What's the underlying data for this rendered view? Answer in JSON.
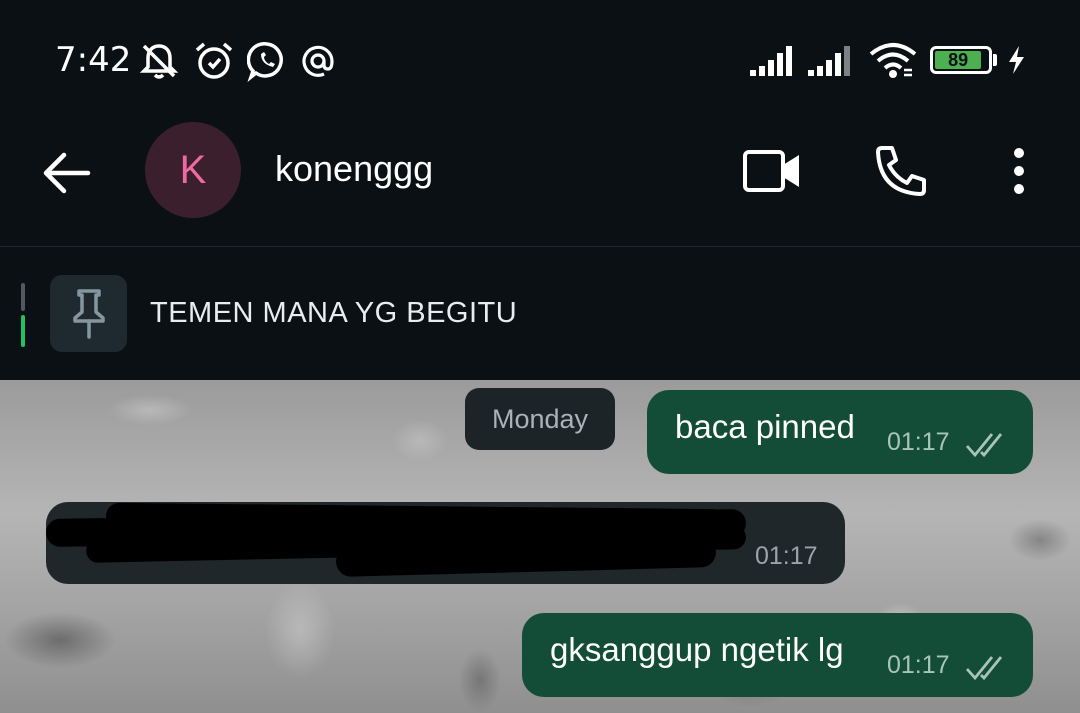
{
  "status_bar": {
    "time": "7:42",
    "battery": "89",
    "icons": [
      "muted-bell-icon",
      "alarm-icon",
      "whatsapp-icon",
      "at-icon",
      "signal-icon",
      "signal-icon",
      "wifi-icon",
      "battery-icon",
      "charging-icon"
    ]
  },
  "header": {
    "avatar_initial": "K",
    "contact_name": "konenggg",
    "icons": [
      "back-arrow-icon",
      "video-call-icon",
      "phone-icon",
      "more-vert-icon"
    ]
  },
  "pinned": {
    "text": "TEMEN MANA YG BEGITU",
    "icon": "pin-icon"
  },
  "chat": {
    "date_separator": "Monday",
    "messages": [
      {
        "direction": "out",
        "text": "baca pinned",
        "time": "01:17",
        "status": "read"
      },
      {
        "direction": "in",
        "text": "",
        "time": "01:17",
        "redacted": true
      },
      {
        "direction": "out",
        "text": "gksanggup ngetik lg",
        "time": "01:17",
        "status": "read"
      }
    ]
  },
  "colors": {
    "background": "#0b1014",
    "outgoing_bubble": "#144d37",
    "incoming_bubble": "#1f272a",
    "avatar_bg": "#3c1f2c",
    "avatar_text": "#ee6aa3",
    "battery_green": "#4caf50",
    "pin_indicator": "#21c063"
  }
}
